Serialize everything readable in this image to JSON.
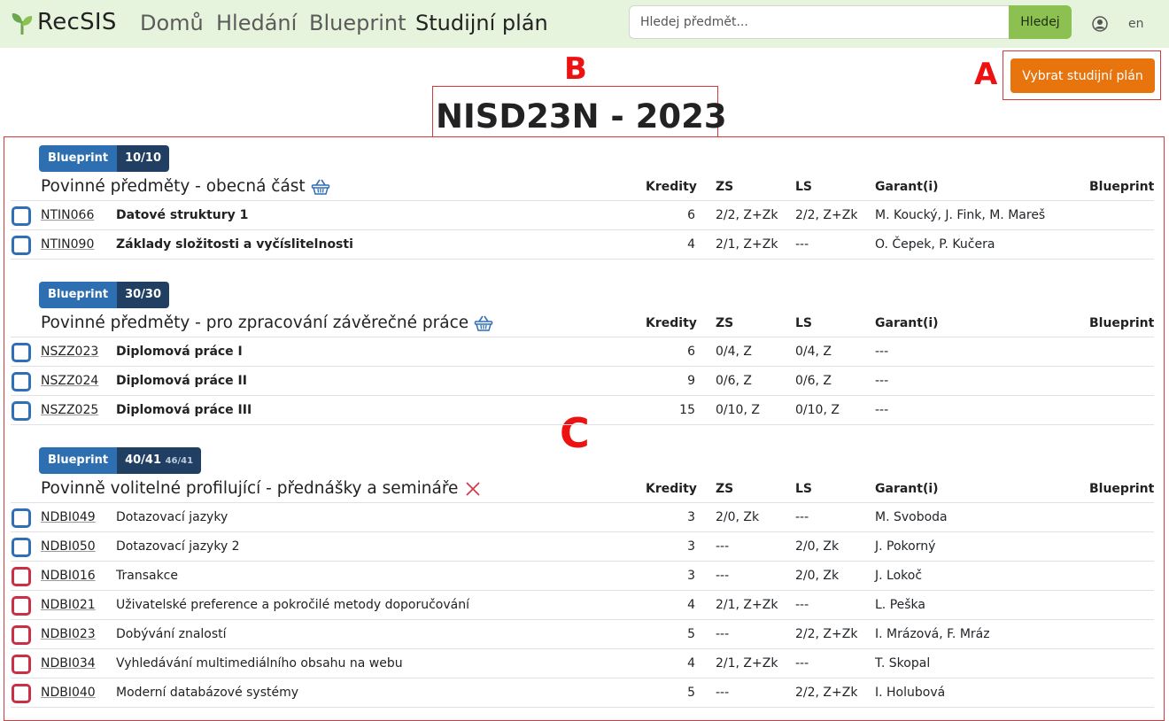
{
  "nav": {
    "brand": "RecSIS",
    "links": [
      "Domů",
      "Hledání",
      "Blueprint",
      "Studijní plán"
    ],
    "search_placeholder": "Hledej předmět...",
    "search_button": "Hledej",
    "lang": "en"
  },
  "annotations": {
    "a": "A",
    "b": "B",
    "c": "C"
  },
  "select_plan_button": "Vybrat studijní plán",
  "plan_title": "NISD23N - 2023",
  "columns": {
    "credits": "Kredity",
    "zs": "ZS",
    "ls": "LS",
    "garant": "Garant(i)",
    "blueprint": "Blueprint"
  },
  "sections": [
    {
      "badge_label": "Blueprint",
      "badge_count": "10/10",
      "badge_extra": "",
      "title": "Povinné předměty - obecná část",
      "rows": [
        {
          "code": "NTIN066",
          "name": "Datové struktury 1",
          "credits": "6",
          "zs": "2/2, Z+Zk",
          "ls": "2/2, Z+Zk",
          "garant": "M. Koucký, J. Fink, M. Mareš",
          "status": "blue"
        },
        {
          "code": "NTIN090",
          "name": "Základy složitosti a vyčíslitelnosti",
          "credits": "4",
          "zs": "2/1, Z+Zk",
          "ls": "---",
          "garant": "O. Čepek, P. Kučera",
          "status": "blue"
        }
      ]
    },
    {
      "badge_label": "Blueprint",
      "badge_count": "30/30",
      "badge_extra": "",
      "title": "Povinné předměty - pro zpracování závěrečné práce",
      "rows": [
        {
          "code": "NSZZ023",
          "name": "Diplomová práce I",
          "credits": "6",
          "zs": "0/4, Z",
          "ls": "0/4, Z",
          "garant": "---",
          "status": "blue"
        },
        {
          "code": "NSZZ024",
          "name": "Diplomová práce II",
          "credits": "9",
          "zs": "0/6, Z",
          "ls": "0/6, Z",
          "garant": "---",
          "status": "blue"
        },
        {
          "code": "NSZZ025",
          "name": "Diplomová práce III",
          "credits": "15",
          "zs": "0/10, Z",
          "ls": "0/10, Z",
          "garant": "---",
          "status": "blue"
        }
      ]
    },
    {
      "badge_label": "Blueprint",
      "badge_count": "40/41",
      "badge_extra": "46/41",
      "title": "Povinně volitelné profilující - přednášky a semináře",
      "rows": [
        {
          "code": "NDBI049",
          "name": "Dotazovací jazyky",
          "credits": "3",
          "zs": "2/0, Zk",
          "ls": "---",
          "garant": "M. Svoboda",
          "status": "blue"
        },
        {
          "code": "NDBI050",
          "name": "Dotazovací jazyky 2",
          "credits": "3",
          "zs": "---",
          "ls": "2/0, Zk",
          "garant": "J. Pokorný",
          "status": "blue"
        },
        {
          "code": "NDBI016",
          "name": "Transakce",
          "credits": "3",
          "zs": "---",
          "ls": "2/0, Zk",
          "garant": "J. Lokoč",
          "status": "red"
        },
        {
          "code": "NDBI021",
          "name": "Uživatelské preference a pokročilé metody doporučování",
          "credits": "4",
          "zs": "2/1, Z+Zk",
          "ls": "---",
          "garant": "L. Peška",
          "status": "red"
        },
        {
          "code": "NDBI023",
          "name": "Dobývání znalostí",
          "credits": "5",
          "zs": "---",
          "ls": "2/2, Z+Zk",
          "garant": "I. Mrázová, F. Mráz",
          "status": "red"
        },
        {
          "code": "NDBI034",
          "name": "Vyhledávání multimediálního obsahu na webu",
          "credits": "4",
          "zs": "2/1, Z+Zk",
          "ls": "---",
          "garant": "T. Skopal",
          "status": "red"
        },
        {
          "code": "NDBI040",
          "name": "Moderní databázové systémy",
          "credits": "5",
          "zs": "---",
          "ls": "2/2, Z+Zk",
          "garant": "I. Holubová",
          "status": "red"
        }
      ]
    }
  ],
  "colors": {
    "navbar_bg": "#e6f4dd",
    "search_button": "#8cc152",
    "accent_orange": "#e8740e",
    "badge_blue": "#2d6fb1",
    "badge_navy": "#213f62",
    "checkbox_blue": "#2e6fb5",
    "checkbox_red": "#c93045",
    "annotation_red": "#d43a3a"
  },
  "icons": {
    "logo": "leaf-logo-icon",
    "user": "user-circle-icon",
    "basket": "basket-icon",
    "remove": "x-icon"
  }
}
